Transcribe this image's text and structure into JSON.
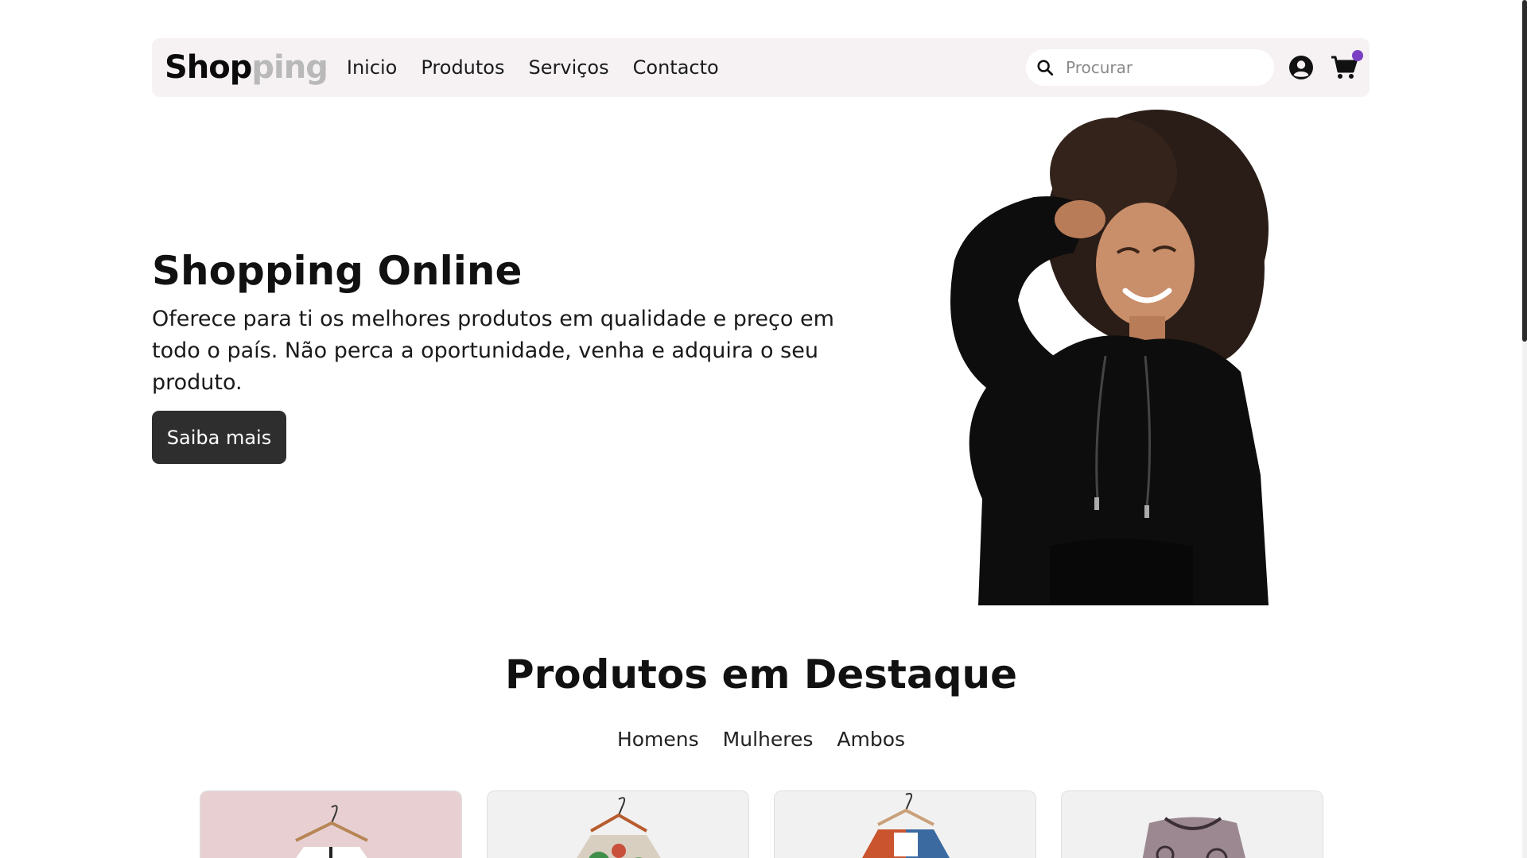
{
  "brand": {
    "part1": "Shop",
    "part2": "ping"
  },
  "nav": {
    "links": [
      "Inicio",
      "Produtos",
      "Serviços",
      "Contacto"
    ]
  },
  "search": {
    "placeholder": "Procurar",
    "value": ""
  },
  "icons": {
    "search": "search-icon",
    "account": "user-circle-icon",
    "cart": "shopping-cart-icon"
  },
  "hero": {
    "title": "Shopping Online",
    "description": "Oferece para ti os melhores produtos em qualidade e preço em todo o país. Não perca a oportunidade, venha e adquira o seu produto.",
    "button_label": "Saiba mais"
  },
  "featured": {
    "title": "Produtos em Destaque",
    "filters": [
      "Homens",
      "Mulheres",
      "Ambos"
    ]
  },
  "colors": {
    "navbar_bg": "#f6f2f3",
    "brand_dark": "#0b0b0b",
    "brand_light": "#b9b9b9",
    "button_bg": "#2e2e2e",
    "cart_badge": "#7b3fc4",
    "card1_bg": "#e8d0d2",
    "card_bg": "#f1f1f1"
  }
}
